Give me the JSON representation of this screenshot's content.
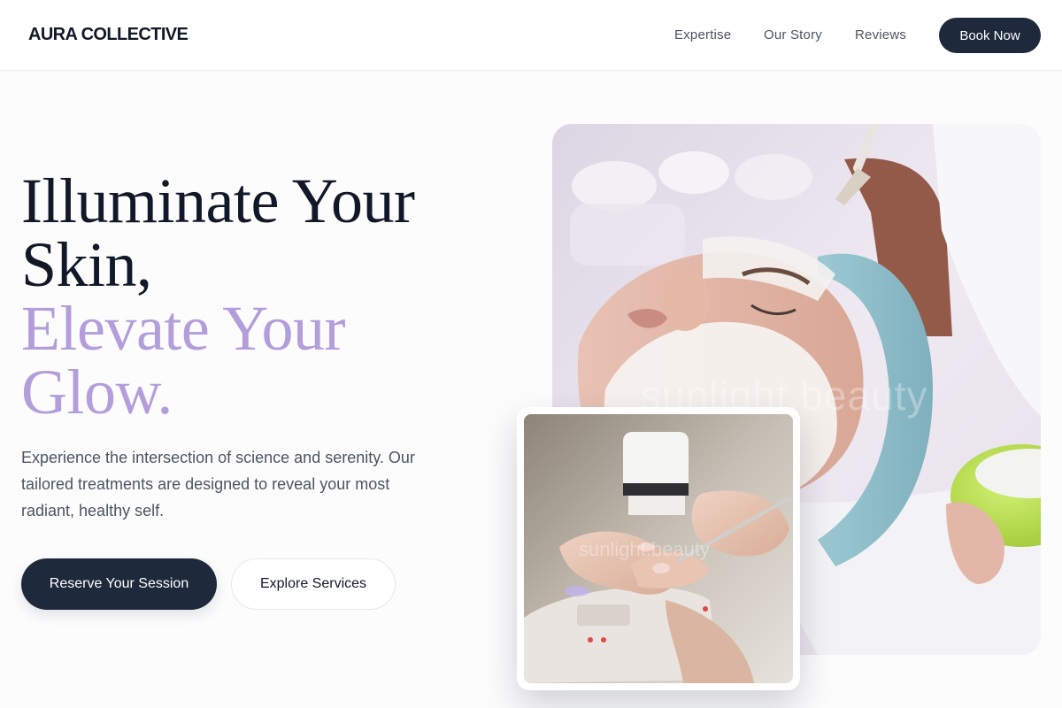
{
  "header": {
    "logo": "AURA COLLECTIVE",
    "nav": [
      {
        "label": "Expertise"
      },
      {
        "label": "Our Story"
      },
      {
        "label": "Reviews"
      }
    ],
    "cta_label": "Book Now"
  },
  "hero": {
    "headline_line1": "Illuminate Your",
    "headline_line2": "Skin,",
    "headline_accent_line1": "Elevate Your",
    "headline_accent_line2": "Glow.",
    "lead": "Experience the intersection of science and serenity. Our tailored treatments are designed to reveal your most radiant, healthy self.",
    "primary_button": "Reserve Your Session",
    "secondary_button": "Explore Services"
  },
  "images": {
    "main_watermark": "sunlight.beauty",
    "inset_watermark": "sunlight.beauty"
  },
  "colors": {
    "accent": "#b39ddb",
    "primary_dark": "#1e293b",
    "heading": "#111827",
    "body_text": "#4b5563"
  }
}
